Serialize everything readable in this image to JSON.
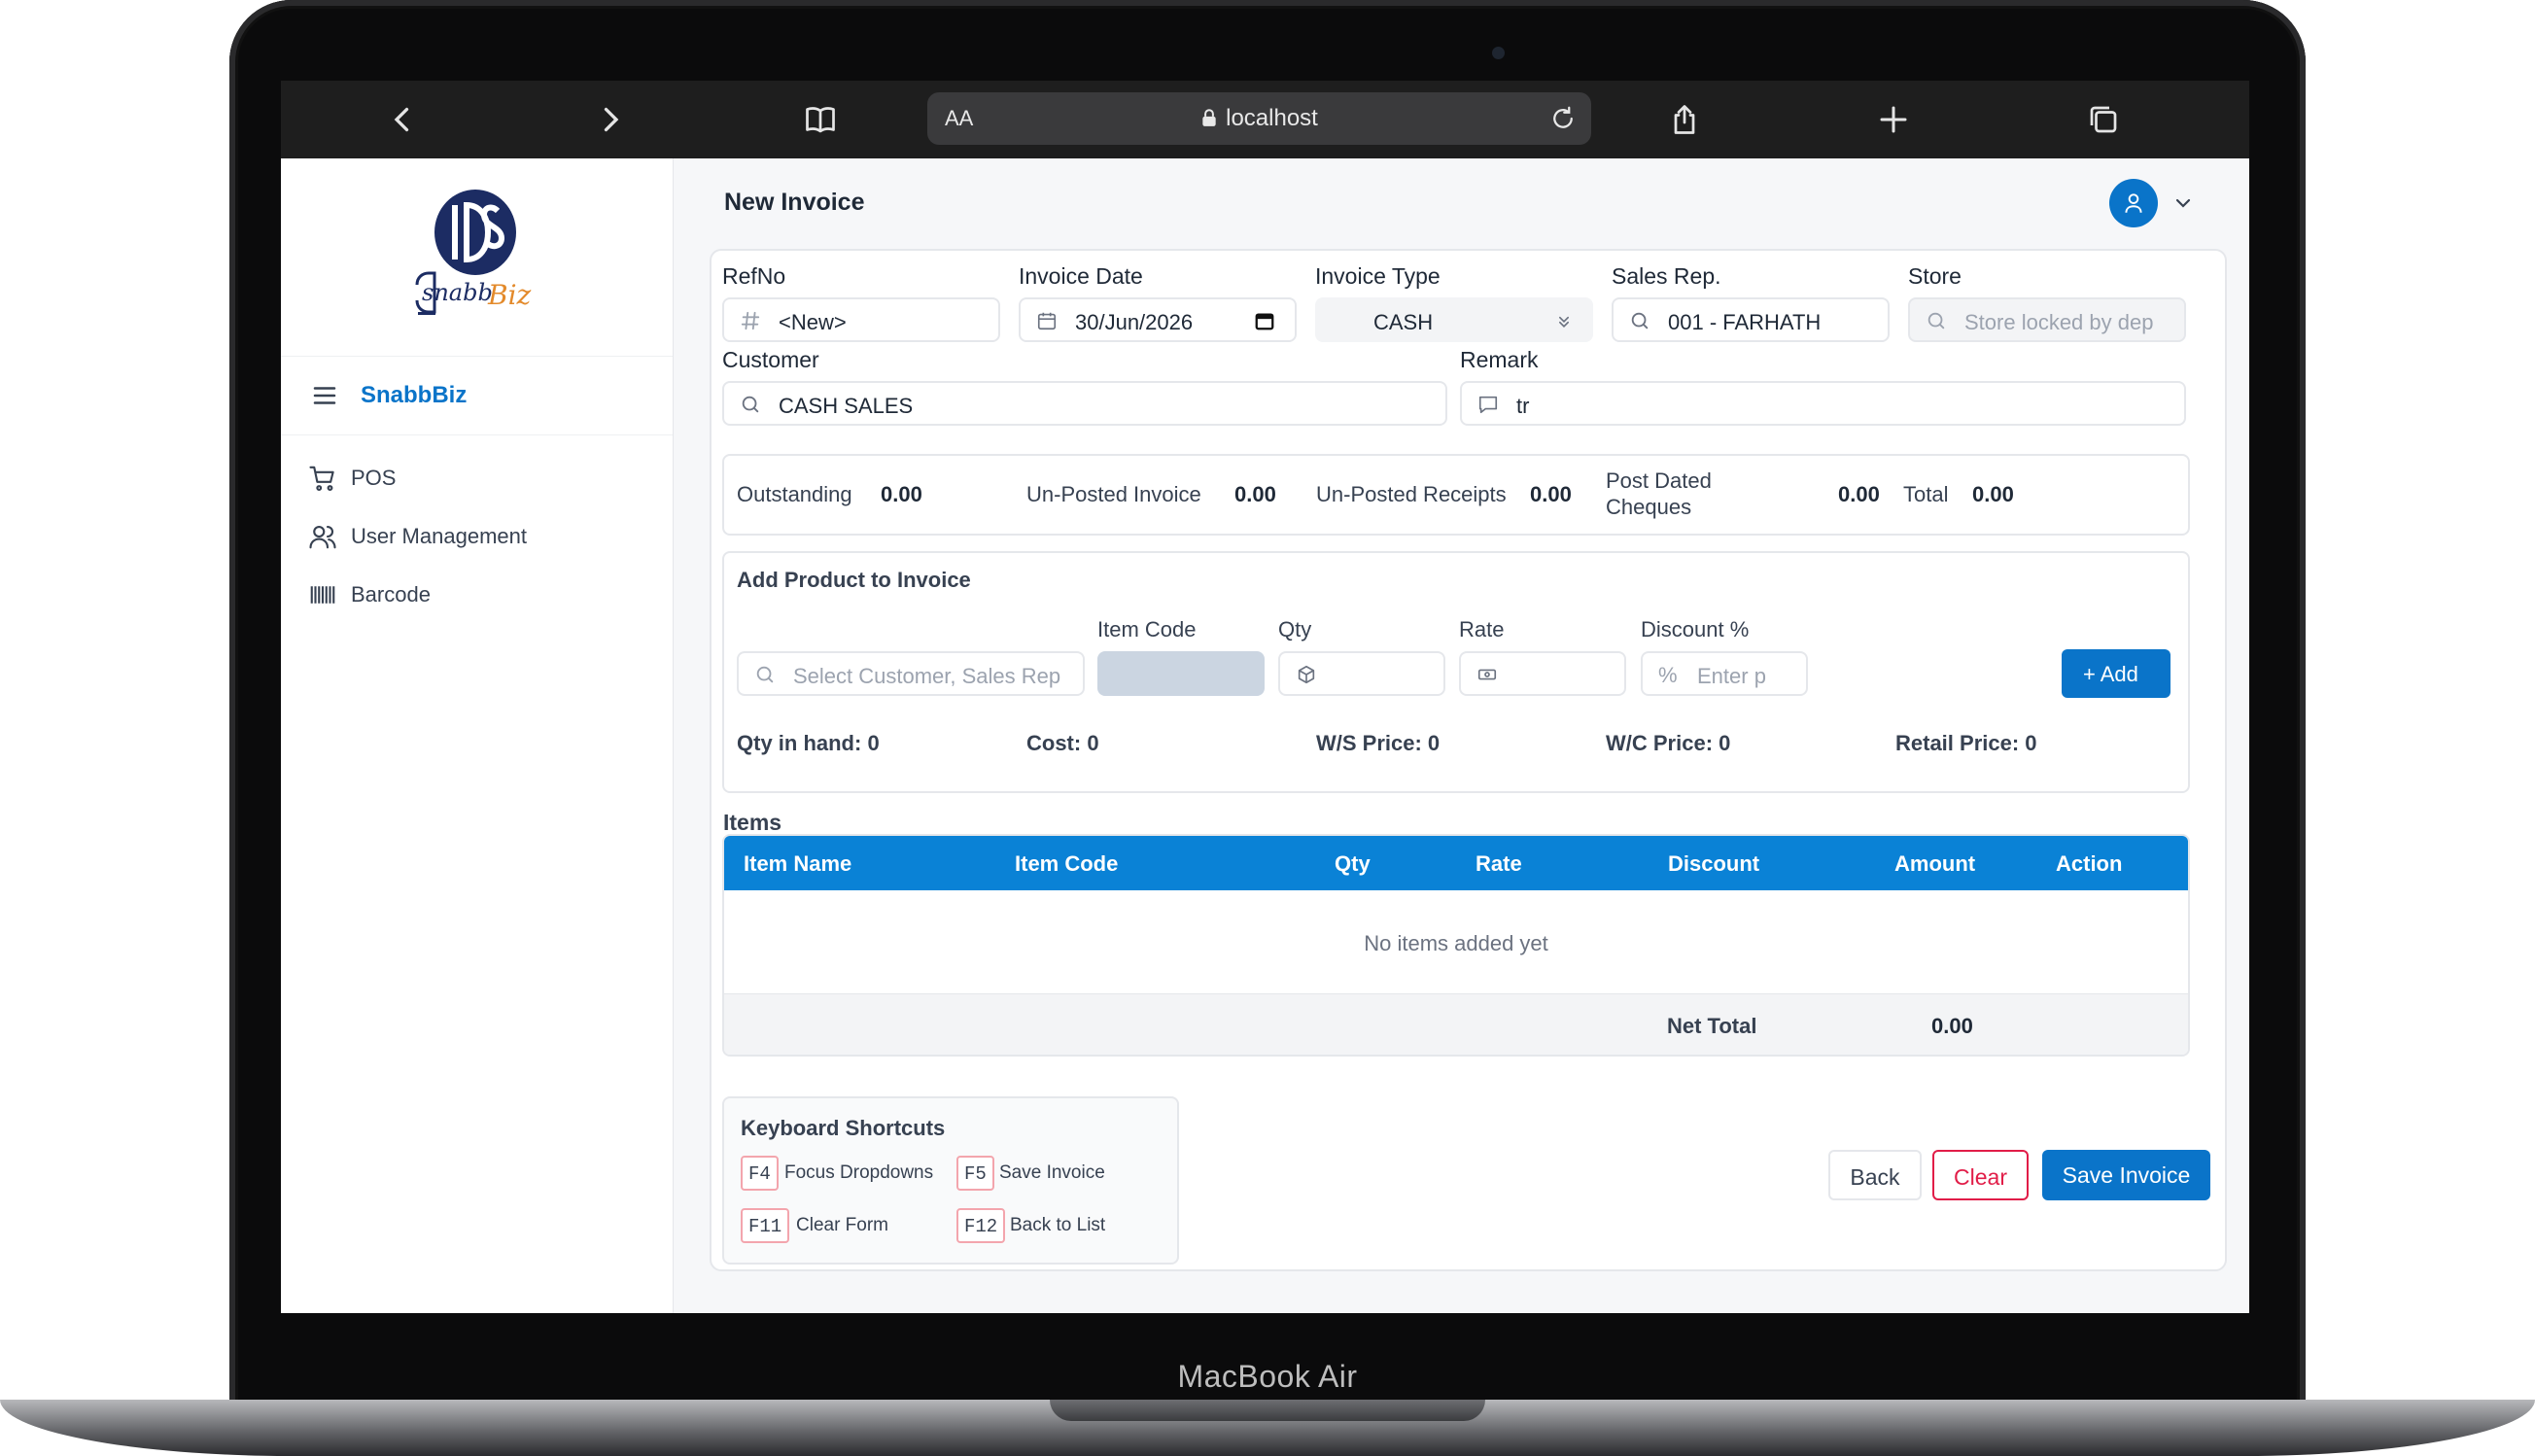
{
  "device": {
    "label": "MacBook Air"
  },
  "browser": {
    "reader_label": "AA",
    "url": "localhost"
  },
  "sidebar": {
    "brand": "SnabbBiz",
    "items": [
      {
        "label": "POS",
        "icon": "cart-icon"
      },
      {
        "label": "User Management",
        "icon": "users-icon"
      },
      {
        "label": "Barcode",
        "icon": "barcode-icon"
      }
    ]
  },
  "header": {
    "title": "New Invoice"
  },
  "form": {
    "refno": {
      "label": "RefNo",
      "value": "<New>"
    },
    "invoice_date": {
      "label": "Invoice Date",
      "value": "30/Jun/2026"
    },
    "invoice_type": {
      "label": "Invoice Type",
      "value": "CASH"
    },
    "sales_rep": {
      "label": "Sales Rep.",
      "value": "001 - FARHATH"
    },
    "store": {
      "label": "Store",
      "placeholder": "Store locked by dep"
    },
    "customer": {
      "label": "Customer",
      "value": "CASH SALES"
    },
    "remark": {
      "label": "Remark",
      "value": "tr"
    }
  },
  "summary": {
    "outstanding_label": "Outstanding",
    "outstanding": "0.00",
    "unposted_invoice_label": "Un-Posted Invoice",
    "unposted_invoice": "0.00",
    "unposted_receipts_label": "Un-Posted Receipts",
    "unposted_receipts": "0.00",
    "post_dated_label_1": "Post Dated",
    "post_dated_label_2": "Cheques",
    "post_dated": "0.00",
    "total_label": "Total",
    "total": "0.00"
  },
  "add_product": {
    "title": "Add Product to Invoice",
    "search_placeholder": "Select Customer, Sales Rep",
    "item_code_label": "Item Code",
    "qty_label": "Qty",
    "rate_label": "Rate",
    "discount_label": "Discount %",
    "discount_placeholder": "Enter p",
    "add_button": "+ Add",
    "qty_in_hand": "Qty in hand: 0",
    "cost": "Cost: 0",
    "ws_price": "W/S Price: 0",
    "wc_price": "W/C Price: 0",
    "retail_price": "Retail Price: 0"
  },
  "items": {
    "title": "Items",
    "columns": [
      "Item Name",
      "Item Code",
      "Qty",
      "Rate",
      "Discount",
      "Amount",
      "Action"
    ],
    "empty_text": "No items added yet",
    "net_total_label": "Net Total",
    "net_total": "0.00"
  },
  "shortcuts": {
    "title": "Keyboard Shortcuts",
    "list": [
      {
        "key": "F4",
        "desc": "Focus Dropdowns"
      },
      {
        "key": "F5",
        "desc": "Save Invoice"
      },
      {
        "key": "F11",
        "desc": "Clear Form"
      },
      {
        "key": "F12",
        "desc": "Back to List"
      }
    ]
  },
  "actions": {
    "back": "Back",
    "clear": "Clear",
    "save": "Save Invoice"
  },
  "colors": {
    "primary": "#0a74c9",
    "table_header": "#0a82d6",
    "danger": "#e11d48"
  }
}
